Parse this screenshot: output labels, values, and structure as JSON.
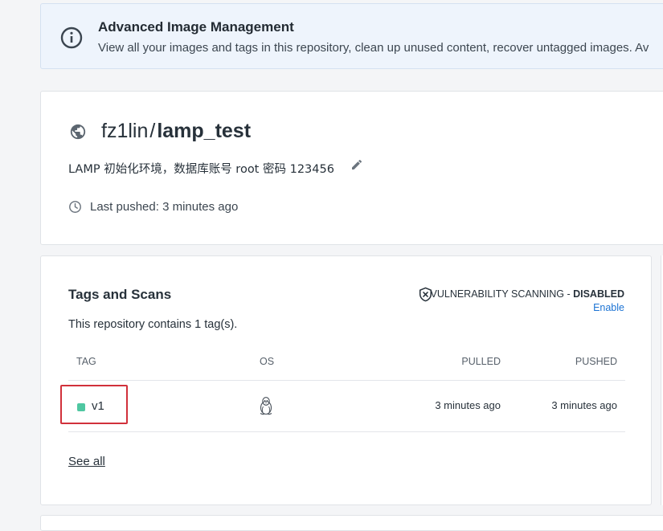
{
  "banner": {
    "icon": "info-circle-icon",
    "title": "Advanced Image Management",
    "text": "View all your images and tags in this repository, clean up unused content, recover untagged images. Av"
  },
  "repo": {
    "visibility_icon": "globe-icon",
    "namespace": "fz1lin",
    "separator": "/",
    "name": "lamp_test",
    "description": "LAMP 初始化环境，数据库账号 root 密码 123456",
    "edit_icon": "pencil-icon",
    "last_pushed": "Last pushed: 3 minutes ago"
  },
  "tags": {
    "title": "Tags and Scans",
    "count_text": "This repository contains 1 tag(s).",
    "vulnerability": {
      "label": "VULNERABILITY SCANNING - ",
      "status": "DISABLED",
      "enable_link": "Enable"
    },
    "columns": {
      "tag": "TAG",
      "os": "OS",
      "pulled": "PULLED",
      "pushed": "PUSHED"
    },
    "rows": [
      {
        "tag": "v1",
        "status_color": "#4fc7a1",
        "os_icon": "linux-penguin-icon",
        "pulled": "3 minutes ago",
        "pushed": "3 minutes ago"
      }
    ],
    "see_all": "See all"
  },
  "colors": {
    "accent": "#1d74d4",
    "highlight": "#d1313b",
    "status_active": "#4fc7a1"
  }
}
